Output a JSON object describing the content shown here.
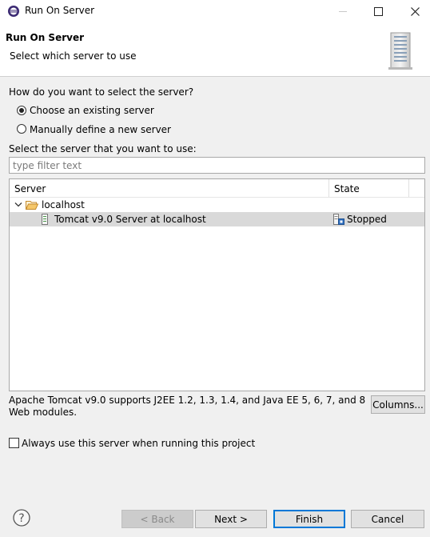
{
  "window": {
    "title": "Run On Server"
  },
  "banner": {
    "title": "Run On Server",
    "subtitle": "Select which server to use"
  },
  "selection": {
    "question": "How do you want to select the server?",
    "options": [
      {
        "label": "Choose an existing server",
        "selected": true
      },
      {
        "label": "Manually define a new server",
        "selected": false
      }
    ]
  },
  "filter": {
    "label": "Select the server that you want to use:",
    "placeholder": "type filter text",
    "value": ""
  },
  "tree": {
    "columns": [
      "Server",
      "State"
    ],
    "host": "localhost",
    "servers": [
      {
        "name": "Tomcat v9.0 Server at localhost",
        "state": "Stopped"
      }
    ]
  },
  "description": "Apache Tomcat v9.0 supports J2EE 1.2, 1.3, 1.4, and Java EE 5, 6, 7, and 8 Web modules.",
  "columns_button": "Columns...",
  "always_use": {
    "label": "Always use this server when running this project",
    "checked": false
  },
  "footer": {
    "back": "< Back",
    "next": "Next >",
    "finish": "Finish",
    "cancel": "Cancel"
  },
  "colors": {
    "accent": "#0078d7",
    "selection": "#d9d9d9",
    "folder": "#e8a94a"
  }
}
